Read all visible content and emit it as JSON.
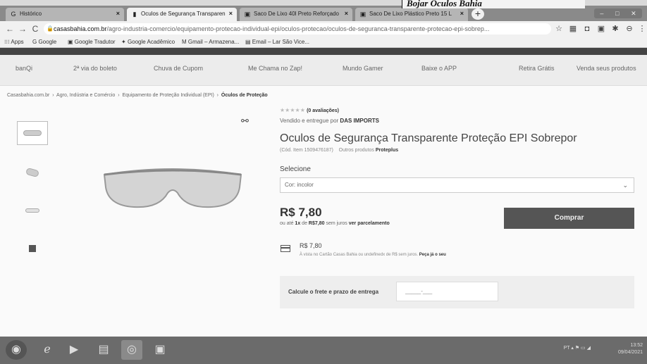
{
  "overlay_title": "Bojar Óculos Bahia",
  "tabs": [
    {
      "icon": "G",
      "label": "Histórico"
    },
    {
      "icon": "▮",
      "label": "Oculos de Segurança Transparen"
    },
    {
      "icon": "▣",
      "label": "Saco De Lixo 40l Preto Reforçado"
    },
    {
      "icon": "▣",
      "label": "Saco De Lixo Plástico Preto 15 L"
    }
  ],
  "address": {
    "domain": "casasbahia.com.br",
    "path": "/agro-industria-comercio/equipamento-protecao-individual-epi/oculos-protecao/oculos-de-seguranca-transparente-protecao-epi-sobrep..."
  },
  "bookmarks": [
    "Apps",
    "Google",
    "Google Tradutor",
    "Google Acadêmico",
    "Gmail – Armazena...",
    "Email – Lar São Vice..."
  ],
  "site_nav": [
    "banQi",
    "2ª via do boleto",
    "Chuva de Cupom",
    "Me Chama no Zap!",
    "Mundo Gamer",
    "Baixe o APP",
    "Retira Grátis",
    "Venda seus produtos"
  ],
  "breadcrumb": {
    "items": [
      "Casasbahia.com.br",
      "Agro, Indústria e Comércio",
      "Equipamento de Proteção Individual (EPI)"
    ],
    "current": "Óculos de Proteção"
  },
  "product": {
    "stars": "★★★★★",
    "reviews": "(0 avaliações)",
    "seller_prefix": "Vendido e entregue por",
    "seller": "DAS IMPORTS",
    "title": "Oculos de Segurança Transparente Proteção EPI Sobrepor",
    "code": "(Cód. Item 1509476187)",
    "other_prefix": "Outros produtos",
    "brand": "Proteplus",
    "select_label": "Selecione",
    "select_value": "Cor: incolor",
    "price": "R$ 7,80",
    "installments_prefix": "ou até",
    "installments_qty": "1x",
    "installments_de": "de",
    "installments_value": "R$7,80",
    "installments_mid": "sem juros",
    "installments_link": "ver parcelamento",
    "buy_label": "Comprar",
    "card_price": "R$ 7,80",
    "card_text": "À vista no Cartão Casas Bahia ou undefinedx de R$ sem juros.",
    "card_link": "Peça já o seu",
    "frete_label": "Calcule o frete e prazo de entrega",
    "cep_placeholder": "_____-___"
  },
  "tray": {
    "lang": "PT",
    "time": "13:52",
    "date": "09/04/2021"
  }
}
